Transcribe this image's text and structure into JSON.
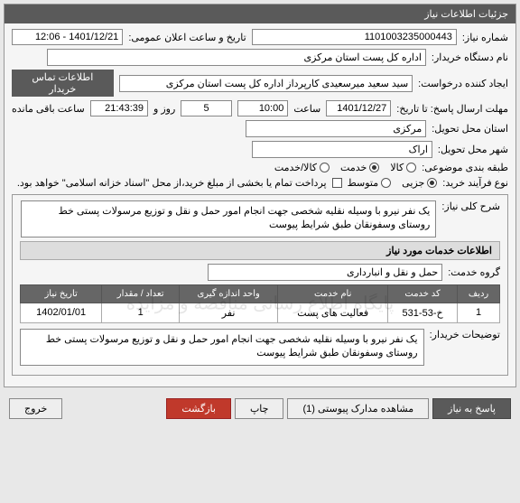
{
  "header": {
    "title": "جزئیات اطلاعات نیاز"
  },
  "fields": {
    "need_number_label": "شماره نیاز:",
    "need_number": "1101003235000443",
    "announce_label": "تاریخ و ساعت اعلان عمومی:",
    "announce_value": "1401/12/21 - 12:06",
    "buyer_org_label": "نام دستگاه خریدار:",
    "buyer_org": "اداره کل پست استان مرکزی",
    "requester_label": "ایجاد کننده درخواست:",
    "requester": "سید سعید میرسعیدی کارپرداز اداره کل پست استان مرکزی",
    "contact_btn": "اطلاعات تماس خریدار",
    "deadline_label": "مهلت ارسال پاسخ: تا تاریخ:",
    "deadline_date": "1401/12/27",
    "hour_label": "ساعت",
    "deadline_hour": "10:00",
    "day_word": "روز و",
    "days_left": "5",
    "time_left_label": "ساعت باقی مانده",
    "time_left": "21:43:39",
    "delivery_province_label": "استان محل تحویل:",
    "delivery_province": "مرکزی",
    "delivery_city_label": "شهر محل تحویل:",
    "delivery_city": "اراک",
    "subject_class_label": "طبقه بندی موضوعی:",
    "radio_goods": "کالا",
    "radio_service": "خدمت",
    "radio_both": "کالا/خدمت",
    "purchase_type_label": "نوع فرآیند خرید:",
    "radio_minor": "جزیی",
    "radio_medium": "متوسط",
    "checkbox_note": "پرداخت تمام یا بخشی از مبلغ خرید،از محل \"اسناد خزانه اسلامی\" خواهد بود.",
    "general_desc_label": "شرح کلی نیاز:",
    "general_desc": "یک نفر نیرو با وسیله نقلیه شخصی جهت انجام امور حمل و نقل و توزیع مرسولات پستی خط روستای وسفونقان  طبق شرایط پیوست",
    "services_info_header": "اطلاعات خدمات مورد نیاز",
    "service_group_label": "گروه خدمت:",
    "service_group": "حمل و نقل و انبارداری",
    "buyer_notes_label": "توضیحات خریدار:",
    "buyer_notes": "یک نفر نیرو با وسیله نقلیه شخصی جهت انجام امور حمل و نقل و توزیع مرسولات پستی خط روستای وسفونقان  طبق شرایط پیوست"
  },
  "table": {
    "headers": [
      "ردیف",
      "کد خدمت",
      "نام خدمت",
      "واحد اندازه گیری",
      "تعداد / مقدار",
      "تاریخ نیاز"
    ],
    "rows": [
      {
        "idx": "1",
        "code": "خ-53-531",
        "name": "فعالیت های پست",
        "unit": "نفر",
        "qty": "1",
        "date": "1402/01/01"
      }
    ]
  },
  "footer": {
    "reply": "پاسخ به نیاز",
    "attachments": "مشاهده مدارک پیوستی (1)",
    "print": "چاپ",
    "back": "بازگشت",
    "exit": "خروج"
  },
  "watermark": "پایگاه اطلاع رسانی مناقصه و مزایده"
}
